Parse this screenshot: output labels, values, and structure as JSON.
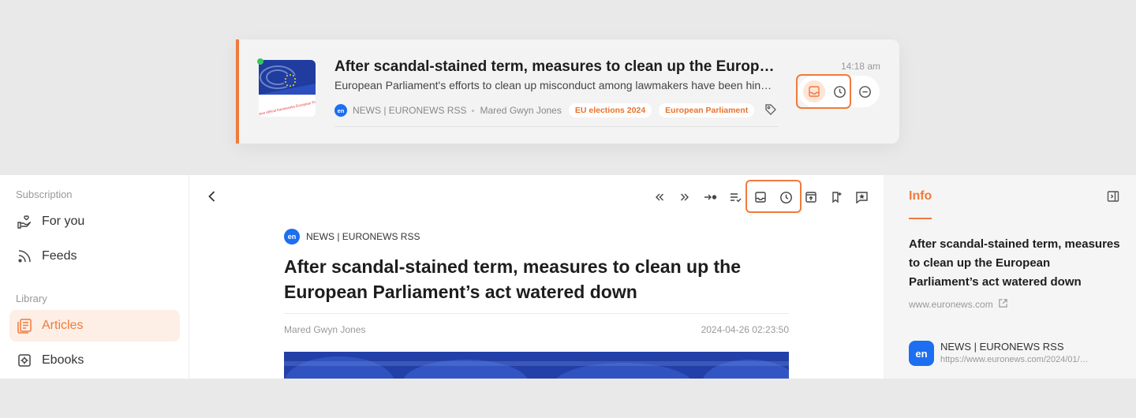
{
  "card": {
    "title": "After scandal-stained term, measures to clean up the Europe…",
    "summary": "European Parliament's efforts to clean up misconduct among lawmakers have been hind…",
    "source": "NEWS | EURONEWS RSS",
    "author": "Mared Gwyn Jones",
    "tags": [
      "EU elections 2024",
      "European Parliament"
    ],
    "time": "14:18 am",
    "thumb_caption": "New ethical frameworks European Parli",
    "logo_text": "en",
    "accent_color": "#f07a3c",
    "unread_color": "#34c759",
    "actions": [
      "inbox-icon",
      "clock-icon",
      "minus-circle-icon"
    ]
  },
  "sidebar": {
    "subscription_label": "Subscription",
    "items_sub": [
      {
        "label": "For you",
        "icon": "hand-heart-icon"
      },
      {
        "label": "Feeds",
        "icon": "rss-icon"
      }
    ],
    "library_label": "Library",
    "items_lib": [
      {
        "label": "Articles",
        "icon": "articles-icon",
        "active": true
      },
      {
        "label": "Ebooks",
        "icon": "ebook-icon"
      }
    ]
  },
  "toolbar": {
    "icons": [
      "chevrons-left-icon",
      "chevrons-right-icon",
      "arrow-dot-icon",
      "list-check-icon",
      "inbox-icon",
      "clock-icon",
      "archive-icon",
      "bookmark-icon",
      "star-comment-icon"
    ]
  },
  "article": {
    "source": "NEWS | EURONEWS RSS",
    "logo_text": "en",
    "title": "After scandal-stained term, measures to clean up the European Parliament’s act watered down",
    "author": "Mared Gwyn Jones",
    "date": "2024-04-26 02:23:50"
  },
  "info": {
    "tab_label": "Info",
    "title": "After scandal-stained term, measures to clean up the European Parliament’s act watered down",
    "domain": "www.euronews.com",
    "feed_name": "NEWS | EURONEWS RSS",
    "feed_url": "https://www.euronews.com/2024/01/…",
    "logo_text": "en"
  }
}
